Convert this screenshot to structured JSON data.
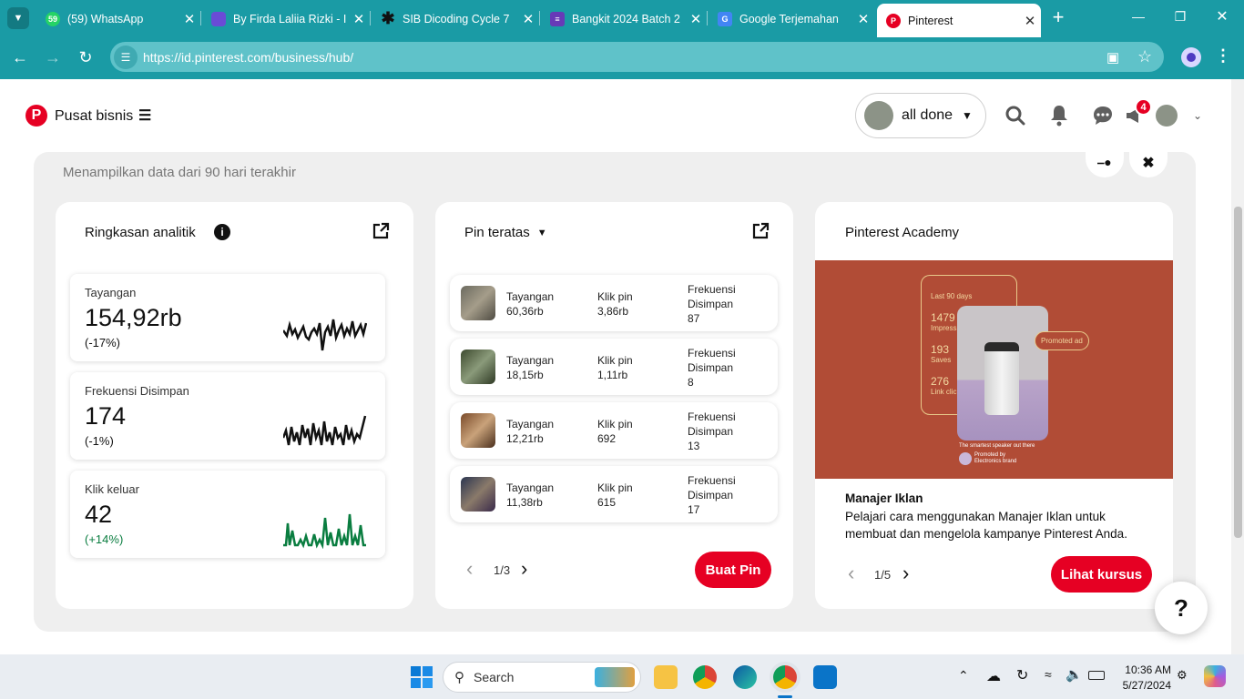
{
  "browser": {
    "tabs": [
      {
        "label": "(59) WhatsApp",
        "icon": "whatsapp-icon",
        "badge": "59"
      },
      {
        "label": "By Firda Laliia Rizki - I",
        "icon": "shield-icon"
      },
      {
        "label": "SIB Dicoding Cycle 7",
        "icon": "asterisk-icon"
      },
      {
        "label": "Bangkit 2024 Batch 2",
        "icon": "forms-icon"
      },
      {
        "label": "Google Terjemahan",
        "icon": "translate-icon"
      },
      {
        "label": "Pinterest",
        "icon": "pinterest-icon"
      }
    ],
    "url": "https://id.pinterest.com/business/hub/"
  },
  "header": {
    "title": "Pusat bisnis",
    "account_name": "all done",
    "notification_badge": "4"
  },
  "main": {
    "range_text": "Menampilkan data dari 90 hari terakhir",
    "analytics": {
      "title": "Ringkasan analitik",
      "metrics": [
        {
          "label": "Tayangan",
          "value": "154,92rb",
          "change": "(-17%)",
          "color": "#111111"
        },
        {
          "label": "Frekuensi Disimpan",
          "value": "174",
          "change": "(-1%)",
          "color": "#111111"
        },
        {
          "label": "Klik keluar",
          "value": "42",
          "change": "(+14%)",
          "color": "#0a7d40"
        }
      ]
    },
    "top_pins": {
      "title": "Pin teratas",
      "col1_label": "Tayangan",
      "col2_label": "Klik pin",
      "col3_label": "Frekuensi Disimpan",
      "rows": [
        {
          "views": "60,36rb",
          "clicks": "3,86rb",
          "saves": "87"
        },
        {
          "views": "18,15rb",
          "clicks": "1,11rb",
          "saves": "8"
        },
        {
          "views": "12,21rb",
          "clicks": "692",
          "saves": "13"
        },
        {
          "views": "11,38rb",
          "clicks": "615",
          "saves": "17"
        }
      ],
      "page": "1/3",
      "button": "Buat Pin"
    },
    "academy": {
      "title": "Pinterest Academy",
      "promo": {
        "period": "Last 90 days",
        "impressions_value": "1479",
        "impressions_label": "Impress",
        "saves_value": "193",
        "saves_label": "Saves",
        "clicks_value": "276",
        "clicks_label": "Link clic",
        "promoted": "Promoted ad",
        "caption": "The smartest speaker out there",
        "promoted_by": "Promoted by",
        "brand": "Electronics brand"
      },
      "course_title": "Manajer Iklan",
      "course_desc": "Pelajari cara menggunakan Manajer Iklan untuk membuat dan mengelola kampanye Pinterest Anda.",
      "page": "1/5",
      "button": "Lihat kursus"
    },
    "help": "?"
  },
  "taskbar": {
    "search": "Search",
    "time": "10:36 AM",
    "date": "5/27/2024"
  },
  "colors": {
    "teal": "#1a9ba5",
    "brand_red": "#e60023",
    "positive": "#0a7d40"
  }
}
